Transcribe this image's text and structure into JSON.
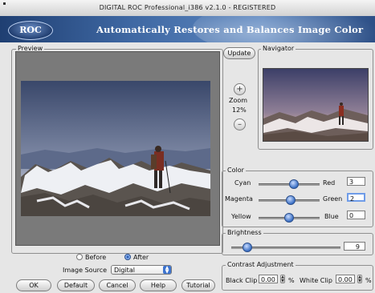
{
  "window": {
    "title": "DIGITAL ROC Professional_i386 v2.1.0 - REGISTERED"
  },
  "banner": {
    "logo_text": "ROC",
    "tagline": "Automatically Restores and Balances Image Color"
  },
  "preview": {
    "legend": "Preview",
    "view_options": [
      {
        "label": "Before",
        "selected": false
      },
      {
        "label": "After",
        "selected": true
      }
    ],
    "image_source_label": "Image Source",
    "image_source_value": "Digital"
  },
  "buttons": {
    "ok": "OK",
    "default": "Default",
    "cancel": "Cancel",
    "help": "Help",
    "tutorial": "Tutorial",
    "update": "Update"
  },
  "navigator": {
    "legend": "Navigator",
    "zoom_label": "Zoom",
    "zoom_value": "12%",
    "zoom_in": "+",
    "zoom_out": "–"
  },
  "color": {
    "legend": "Color",
    "rows": [
      {
        "left": "Cyan",
        "right": "Red",
        "value": "3",
        "level": 0.62
      },
      {
        "left": "Magenta",
        "right": "Green",
        "value": "2",
        "level": 0.58
      },
      {
        "left": "Yellow",
        "right": "Blue",
        "value": "0",
        "level": 0.5
      }
    ]
  },
  "brightness": {
    "legend": "Brightness",
    "value": "9",
    "level": 0.12
  },
  "contrast": {
    "legend": "Contrast Adjustment",
    "black_clip_label": "Black Clip",
    "black_clip_value": "0.00",
    "white_clip_label": "White Clip",
    "white_clip_value": "0.00",
    "unit": "%"
  },
  "colors": {
    "banner": "#3f68a3",
    "accent": "#3a6fc4"
  }
}
